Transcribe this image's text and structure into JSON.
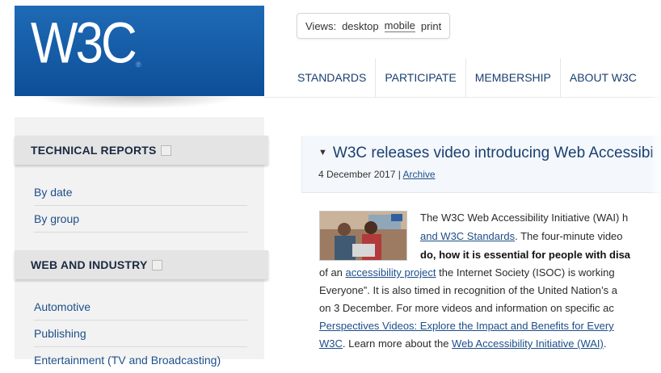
{
  "logo": {
    "text": "W3C",
    "registered": "®"
  },
  "views": {
    "label": "Views:",
    "options": [
      "desktop",
      "mobile",
      "print"
    ]
  },
  "nav": {
    "items": [
      "STANDARDS",
      "PARTICIPATE",
      "MEMBERSHIP",
      "ABOUT W3C"
    ]
  },
  "sidebar": {
    "technical_reports": {
      "heading": "TECHNICAL REPORTS",
      "links": [
        "By date",
        "By group"
      ]
    },
    "web_and_industry": {
      "heading": "WEB AND INDUSTRY",
      "links": [
        "Automotive",
        "Publishing",
        "Entertainment (TV and Broadcasting)"
      ]
    }
  },
  "news": {
    "title": "W3C releases video introducing Web Accessibi",
    "date": "4 December 2017",
    "separator": " | ",
    "archive_link": "Archive",
    "lines": {
      "l1": "The W3C Web Accessibility Initiative (WAI) h",
      "l2_link": "and W3C Standards",
      "l2_rest": ". The four-minute video",
      "l3_bold": "do, how it is essential for people with disa",
      "l4_pre": "of an ",
      "l4_link": "accessibility project",
      "l4_rest": " the Internet Society (ISOC) is working",
      "l5": "Everyone”. It is also timed in recognition of the United Nation’s a",
      "l6": "on 3 December. For more videos and information on specific ac",
      "l7_link": "Perspectives Videos: Explore the Impact and Benefits for Every",
      "l8_link1": "W3C",
      "l8_mid": ". Learn more about the ",
      "l8_link2": "Web Accessibility Initiative (WAI)",
      "l8_end": "."
    }
  },
  "colors": {
    "logo_blue": "#0d4f98",
    "link_blue": "#1d4e89",
    "nav_text": "#1a3f70"
  }
}
